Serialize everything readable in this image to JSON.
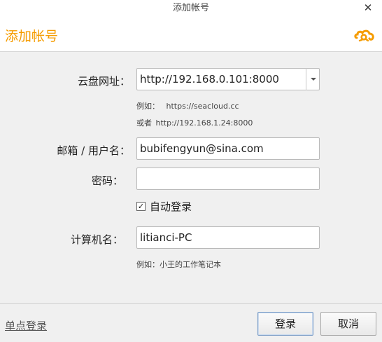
{
  "window": {
    "title": "添加帐号",
    "close_glyph": "✕"
  },
  "header": {
    "title": "添加帐号",
    "logo_icon": "seafile-logo-icon",
    "accent_color": "#f59c00"
  },
  "form": {
    "server_label": "云盘网址：",
    "server_value": "http://192.168.0.101:8000",
    "server_hint_1_prefix": "例如：",
    "server_hint_1_value": "https://seacloud.cc",
    "server_hint_2_prefix": "或者",
    "server_hint_2_value": "http://192.168.1.24:8000",
    "email_label": "邮箱 / 用户名：",
    "email_value": "bubifengyun@sina.com",
    "password_label": "密码：",
    "password_value": "",
    "auto_login_label": "自动登录",
    "auto_login_checked": "✓",
    "computer_label": "计算机名：",
    "computer_value": "litianci-PC",
    "computer_hint": "例如：小王的工作笔记本"
  },
  "footer": {
    "sso_label": "单点登录",
    "login_label": "登录",
    "cancel_label": "取消"
  }
}
